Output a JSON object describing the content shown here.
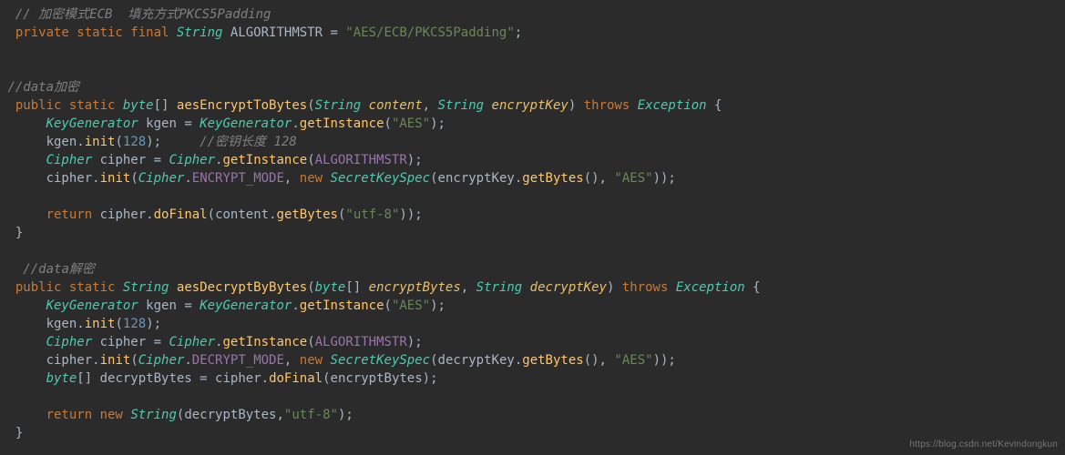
{
  "watermark": "https://blog.csdn.net/Kevindongkun",
  "code": {
    "lines": [
      [
        {
          "cls": "op",
          "t": "  "
        },
        {
          "cls": "c",
          "t": "// 加密模式ECB  填充方式PKCS5Padding"
        }
      ],
      [
        {
          "cls": "op",
          "t": "  "
        },
        {
          "cls": "kw",
          "t": "private static final"
        },
        {
          "cls": "op",
          "t": " "
        },
        {
          "cls": "ty",
          "t": "String"
        },
        {
          "cls": "op",
          "t": " "
        },
        {
          "cls": "id",
          "t": "ALGORITHMSTR"
        },
        {
          "cls": "op",
          "t": " = "
        },
        {
          "cls": "st",
          "t": "\"AES/ECB/PKCS5Padding\""
        },
        {
          "cls": "op",
          "t": ";"
        }
      ],
      [],
      [],
      [
        {
          "cls": "op",
          "t": " "
        },
        {
          "cls": "c",
          "t": "//data加密"
        }
      ],
      [
        {
          "cls": "op",
          "t": "  "
        },
        {
          "cls": "kw",
          "t": "public static"
        },
        {
          "cls": "op",
          "t": " "
        },
        {
          "cls": "ty",
          "t": "byte"
        },
        {
          "cls": "op",
          "t": "[] "
        },
        {
          "cls": "fn",
          "t": "aesEncryptToBytes"
        },
        {
          "cls": "op",
          "t": "("
        },
        {
          "cls": "ty",
          "t": "String"
        },
        {
          "cls": "op",
          "t": " "
        },
        {
          "cls": "pa",
          "t": "content"
        },
        {
          "cls": "op",
          "t": ", "
        },
        {
          "cls": "ty",
          "t": "String"
        },
        {
          "cls": "op",
          "t": " "
        },
        {
          "cls": "pa",
          "t": "encryptKey"
        },
        {
          "cls": "op",
          "t": ") "
        },
        {
          "cls": "kw",
          "t": "throws"
        },
        {
          "cls": "op",
          "t": " "
        },
        {
          "cls": "ty",
          "t": "Exception"
        },
        {
          "cls": "op",
          "t": " {"
        }
      ],
      [
        {
          "cls": "op",
          "t": "      "
        },
        {
          "cls": "ty",
          "t": "KeyGenerator"
        },
        {
          "cls": "op",
          "t": " "
        },
        {
          "cls": "id",
          "t": "kgen"
        },
        {
          "cls": "op",
          "t": " = "
        },
        {
          "cls": "ty",
          "t": "KeyGenerator"
        },
        {
          "cls": "op",
          "t": "."
        },
        {
          "cls": "fn",
          "t": "getInstance"
        },
        {
          "cls": "op",
          "t": "("
        },
        {
          "cls": "st",
          "t": "\"AES\""
        },
        {
          "cls": "op",
          "t": ");"
        }
      ],
      [
        {
          "cls": "op",
          "t": "      "
        },
        {
          "cls": "id",
          "t": "kgen"
        },
        {
          "cls": "op",
          "t": "."
        },
        {
          "cls": "fn",
          "t": "init"
        },
        {
          "cls": "op",
          "t": "("
        },
        {
          "cls": "nu",
          "t": "128"
        },
        {
          "cls": "op",
          "t": ");     "
        },
        {
          "cls": "c",
          "t": "//密钥长度 128"
        }
      ],
      [
        {
          "cls": "op",
          "t": "      "
        },
        {
          "cls": "ty",
          "t": "Cipher"
        },
        {
          "cls": "op",
          "t": " "
        },
        {
          "cls": "id",
          "t": "cipher"
        },
        {
          "cls": "op",
          "t": " = "
        },
        {
          "cls": "ty",
          "t": "Cipher"
        },
        {
          "cls": "op",
          "t": "."
        },
        {
          "cls": "fn",
          "t": "getInstance"
        },
        {
          "cls": "op",
          "t": "("
        },
        {
          "cls": "cf",
          "t": "ALGORITHMSTR"
        },
        {
          "cls": "op",
          "t": ");"
        }
      ],
      [
        {
          "cls": "op",
          "t": "      "
        },
        {
          "cls": "id",
          "t": "cipher"
        },
        {
          "cls": "op",
          "t": "."
        },
        {
          "cls": "fn",
          "t": "init"
        },
        {
          "cls": "op",
          "t": "("
        },
        {
          "cls": "ty",
          "t": "Cipher"
        },
        {
          "cls": "op",
          "t": "."
        },
        {
          "cls": "cf",
          "t": "ENCRYPT_MODE"
        },
        {
          "cls": "op",
          "t": ", "
        },
        {
          "cls": "kw",
          "t": "new"
        },
        {
          "cls": "op",
          "t": " "
        },
        {
          "cls": "ty",
          "t": "SecretKeySpec"
        },
        {
          "cls": "op",
          "t": "("
        },
        {
          "cls": "id",
          "t": "encryptKey"
        },
        {
          "cls": "op",
          "t": "."
        },
        {
          "cls": "fn",
          "t": "getBytes"
        },
        {
          "cls": "op",
          "t": "(), "
        },
        {
          "cls": "st",
          "t": "\"AES\""
        },
        {
          "cls": "op",
          "t": "));"
        }
      ],
      [],
      [
        {
          "cls": "op",
          "t": "      "
        },
        {
          "cls": "kw",
          "t": "return"
        },
        {
          "cls": "op",
          "t": " "
        },
        {
          "cls": "id",
          "t": "cipher"
        },
        {
          "cls": "op",
          "t": "."
        },
        {
          "cls": "fn",
          "t": "doFinal"
        },
        {
          "cls": "op",
          "t": "("
        },
        {
          "cls": "id",
          "t": "content"
        },
        {
          "cls": "op",
          "t": "."
        },
        {
          "cls": "fn",
          "t": "getBytes"
        },
        {
          "cls": "op",
          "t": "("
        },
        {
          "cls": "st",
          "t": "\"utf-8\""
        },
        {
          "cls": "op",
          "t": "));"
        }
      ],
      [
        {
          "cls": "op",
          "t": "  }"
        }
      ],
      [],
      [
        {
          "cls": "op",
          "t": "   "
        },
        {
          "cls": "c",
          "t": "//data解密"
        }
      ],
      [
        {
          "cls": "op",
          "t": "  "
        },
        {
          "cls": "kw",
          "t": "public static"
        },
        {
          "cls": "op",
          "t": " "
        },
        {
          "cls": "ty",
          "t": "String"
        },
        {
          "cls": "op",
          "t": " "
        },
        {
          "cls": "fn",
          "t": "aesDecryptByBytes"
        },
        {
          "cls": "op",
          "t": "("
        },
        {
          "cls": "ty",
          "t": "byte"
        },
        {
          "cls": "op",
          "t": "[] "
        },
        {
          "cls": "pa",
          "t": "encryptBytes"
        },
        {
          "cls": "op",
          "t": ", "
        },
        {
          "cls": "ty",
          "t": "String"
        },
        {
          "cls": "op",
          "t": " "
        },
        {
          "cls": "pa",
          "t": "decryptKey"
        },
        {
          "cls": "op",
          "t": ") "
        },
        {
          "cls": "kw",
          "t": "throws"
        },
        {
          "cls": "op",
          "t": " "
        },
        {
          "cls": "ty",
          "t": "Exception"
        },
        {
          "cls": "op",
          "t": " {"
        }
      ],
      [
        {
          "cls": "op",
          "t": "      "
        },
        {
          "cls": "ty",
          "t": "KeyGenerator"
        },
        {
          "cls": "op",
          "t": " "
        },
        {
          "cls": "id",
          "t": "kgen"
        },
        {
          "cls": "op",
          "t": " = "
        },
        {
          "cls": "ty",
          "t": "KeyGenerator"
        },
        {
          "cls": "op",
          "t": "."
        },
        {
          "cls": "fn",
          "t": "getInstance"
        },
        {
          "cls": "op",
          "t": "("
        },
        {
          "cls": "st",
          "t": "\"AES\""
        },
        {
          "cls": "op",
          "t": ");"
        }
      ],
      [
        {
          "cls": "op",
          "t": "      "
        },
        {
          "cls": "id",
          "t": "kgen"
        },
        {
          "cls": "op",
          "t": "."
        },
        {
          "cls": "fn",
          "t": "init"
        },
        {
          "cls": "op",
          "t": "("
        },
        {
          "cls": "nu",
          "t": "128"
        },
        {
          "cls": "op",
          "t": ");"
        }
      ],
      [
        {
          "cls": "op",
          "t": "      "
        },
        {
          "cls": "ty",
          "t": "Cipher"
        },
        {
          "cls": "op",
          "t": " "
        },
        {
          "cls": "id",
          "t": "cipher"
        },
        {
          "cls": "op",
          "t": " = "
        },
        {
          "cls": "ty",
          "t": "Cipher"
        },
        {
          "cls": "op",
          "t": "."
        },
        {
          "cls": "fn",
          "t": "getInstance"
        },
        {
          "cls": "op",
          "t": "("
        },
        {
          "cls": "cf",
          "t": "ALGORITHMSTR"
        },
        {
          "cls": "op",
          "t": ");"
        }
      ],
      [
        {
          "cls": "op",
          "t": "      "
        },
        {
          "cls": "id",
          "t": "cipher"
        },
        {
          "cls": "op",
          "t": "."
        },
        {
          "cls": "fn",
          "t": "init"
        },
        {
          "cls": "op",
          "t": "("
        },
        {
          "cls": "ty",
          "t": "Cipher"
        },
        {
          "cls": "op",
          "t": "."
        },
        {
          "cls": "cf",
          "t": "DECRYPT_MODE"
        },
        {
          "cls": "op",
          "t": ", "
        },
        {
          "cls": "kw",
          "t": "new"
        },
        {
          "cls": "op",
          "t": " "
        },
        {
          "cls": "ty",
          "t": "SecretKeySpec"
        },
        {
          "cls": "op",
          "t": "("
        },
        {
          "cls": "id",
          "t": "decryptKey"
        },
        {
          "cls": "op",
          "t": "."
        },
        {
          "cls": "fn",
          "t": "getBytes"
        },
        {
          "cls": "op",
          "t": "(), "
        },
        {
          "cls": "st",
          "t": "\"AES\""
        },
        {
          "cls": "op",
          "t": "));"
        }
      ],
      [
        {
          "cls": "op",
          "t": "      "
        },
        {
          "cls": "ty",
          "t": "byte"
        },
        {
          "cls": "op",
          "t": "[] "
        },
        {
          "cls": "id",
          "t": "decryptBytes"
        },
        {
          "cls": "op",
          "t": " = "
        },
        {
          "cls": "id",
          "t": "cipher"
        },
        {
          "cls": "op",
          "t": "."
        },
        {
          "cls": "fn",
          "t": "doFinal"
        },
        {
          "cls": "op",
          "t": "("
        },
        {
          "cls": "id",
          "t": "encryptBytes"
        },
        {
          "cls": "op",
          "t": ");"
        }
      ],
      [],
      [
        {
          "cls": "op",
          "t": "      "
        },
        {
          "cls": "kw",
          "t": "return new"
        },
        {
          "cls": "op",
          "t": " "
        },
        {
          "cls": "ty",
          "t": "String"
        },
        {
          "cls": "op",
          "t": "("
        },
        {
          "cls": "id",
          "t": "decryptBytes"
        },
        {
          "cls": "op",
          "t": ","
        },
        {
          "cls": "st",
          "t": "\"utf-8\""
        },
        {
          "cls": "op",
          "t": ");"
        }
      ],
      [
        {
          "cls": "op",
          "t": "  }"
        }
      ]
    ]
  }
}
